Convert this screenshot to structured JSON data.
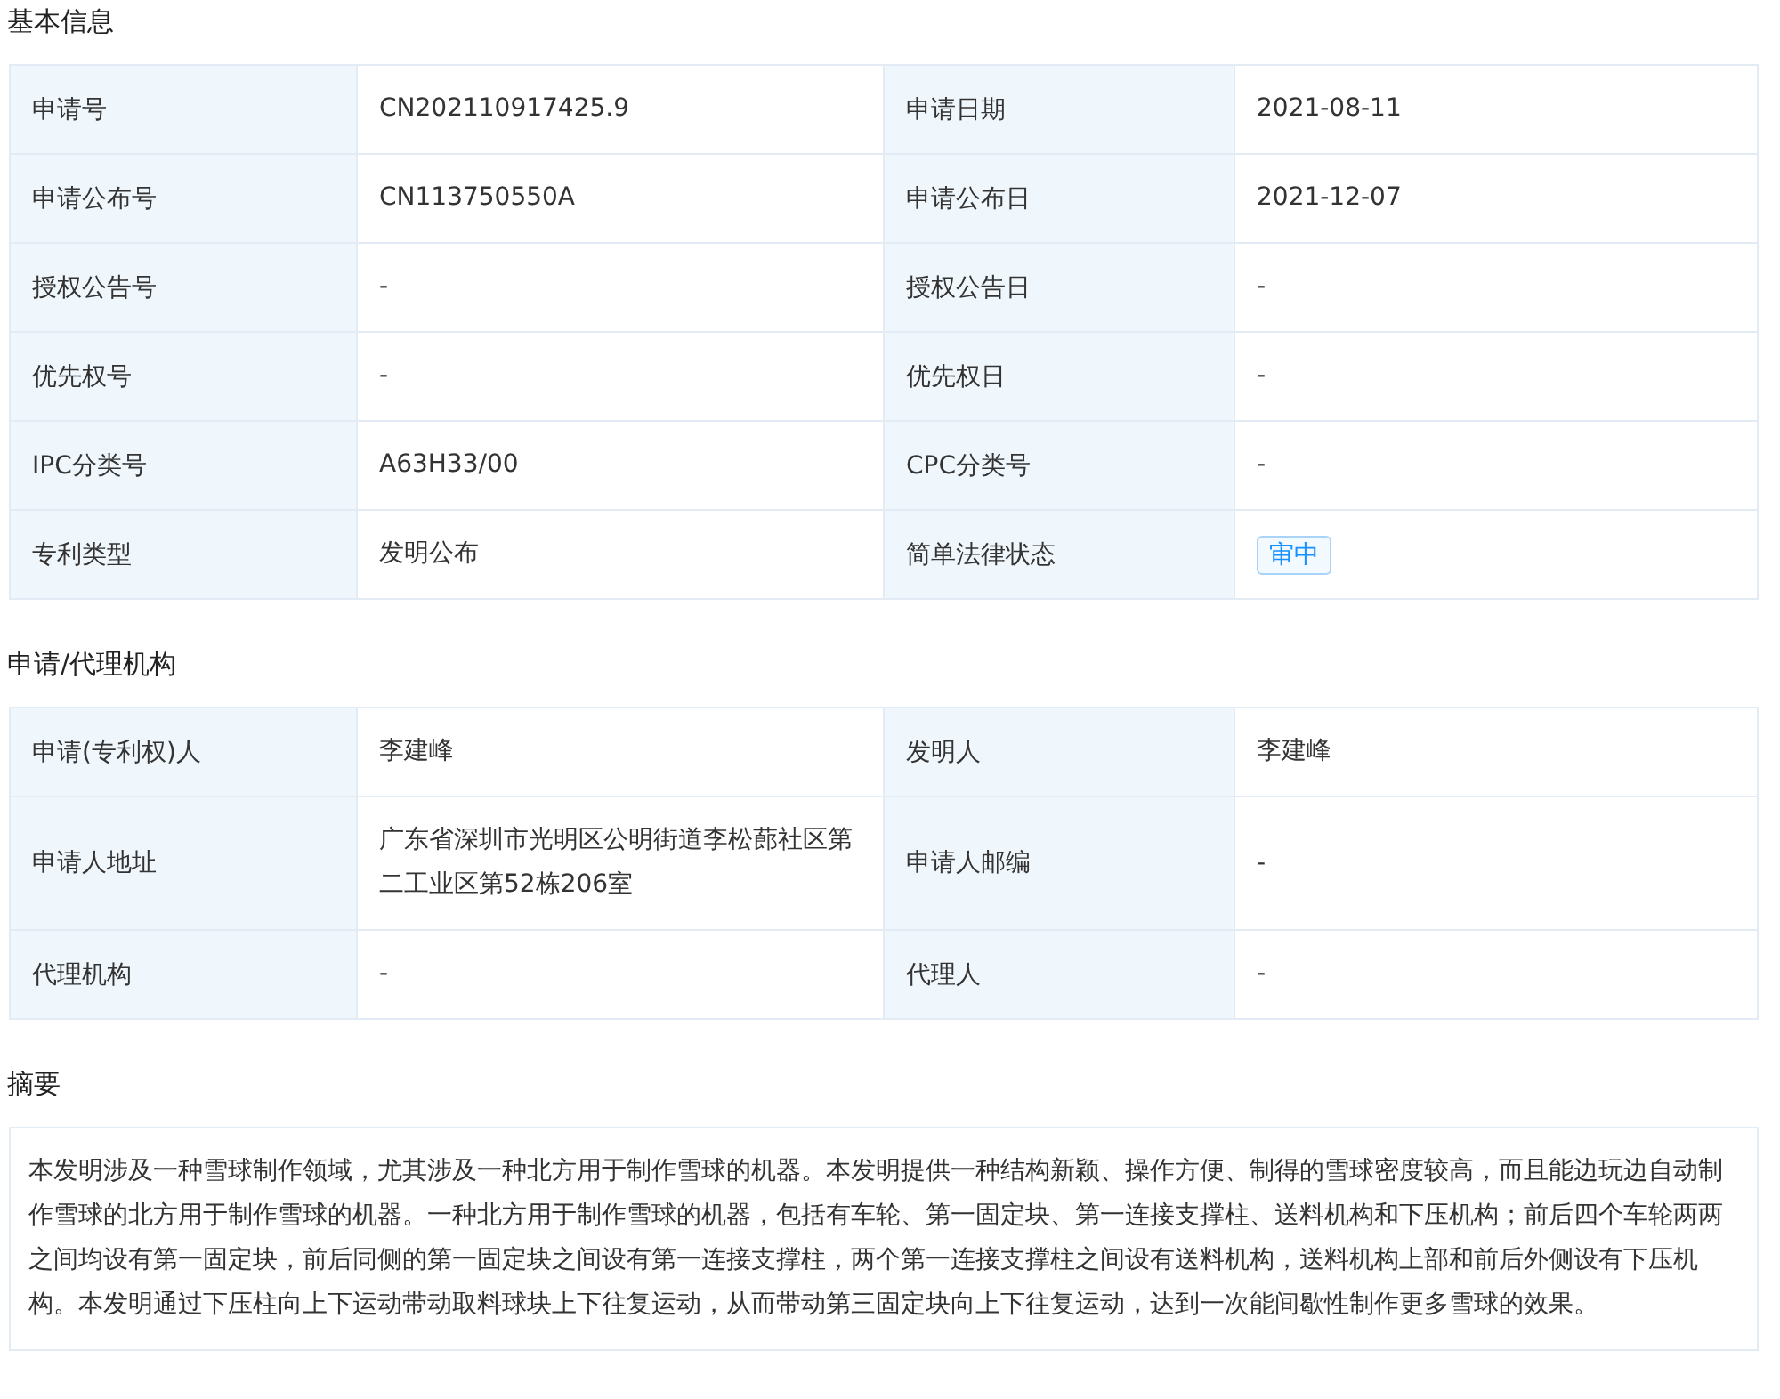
{
  "sections": [
    {
      "title": "基本信息",
      "kind": "table",
      "rows": [
        [
          {
            "label": "申请号",
            "value": "CN202110917425.9",
            "kind": "text"
          },
          {
            "label": "申请日期",
            "value": "2021-08-11",
            "kind": "text"
          }
        ],
        [
          {
            "label": "申请公布号",
            "value": "CN113750550A",
            "kind": "text"
          },
          {
            "label": "申请公布日",
            "value": "2021-12-07",
            "kind": "text"
          }
        ],
        [
          {
            "label": "授权公告号",
            "value": "-",
            "kind": "text"
          },
          {
            "label": "授权公告日",
            "value": "-",
            "kind": "text"
          }
        ],
        [
          {
            "label": "优先权号",
            "value": "-",
            "kind": "text"
          },
          {
            "label": "优先权日",
            "value": "-",
            "kind": "text"
          }
        ],
        [
          {
            "label": "IPC分类号",
            "value": "A63H33/00",
            "kind": "text"
          },
          {
            "label": "CPC分类号",
            "value": "-",
            "kind": "text"
          }
        ],
        [
          {
            "label": "专利类型",
            "value": "发明公布",
            "kind": "text"
          },
          {
            "label": "简单法律状态",
            "value": "审中",
            "kind": "tag"
          }
        ]
      ]
    },
    {
      "title": "申请/代理机构",
      "kind": "table",
      "rows": [
        [
          {
            "label": "申请(专利权)人",
            "value": "李建峰",
            "kind": "text"
          },
          {
            "label": "发明人",
            "value": "李建峰",
            "kind": "text"
          }
        ],
        [
          {
            "label": "申请人地址",
            "value": "广东省深圳市光明区公明街道李松蓢社区第二工业区第52栋206室",
            "kind": "text"
          },
          {
            "label": "申请人邮编",
            "value": "-",
            "kind": "text"
          }
        ],
        [
          {
            "label": "代理机构",
            "value": "-",
            "kind": "text"
          },
          {
            "label": "代理人",
            "value": "-",
            "kind": "text"
          }
        ]
      ]
    },
    {
      "title": "摘要",
      "kind": "text",
      "text": "本发明涉及一种雪球制作领域，尤其涉及一种北方用于制作雪球的机器。本发明提供一种结构新颖、操作方便、制得的雪球密度较高，而且能边玩边自动制作雪球的北方用于制作雪球的机器。一种北方用于制作雪球的机器，包括有车轮、第一固定块、第一连接支撑柱、送料机构和下压机构；前后四个车轮两两之间均设有第一固定块，前后同侧的第一固定块之间设有第一连接支撑柱，两个第一连接支撑柱之间设有送料机构，送料机构上部和前后外侧设有下压机构。本发明通过下压柱向上下运动带动取料球块上下往复运动，从而带动第三固定块向上下往复运动，达到一次能间歇性制作更多雪球的效果。"
    }
  ]
}
